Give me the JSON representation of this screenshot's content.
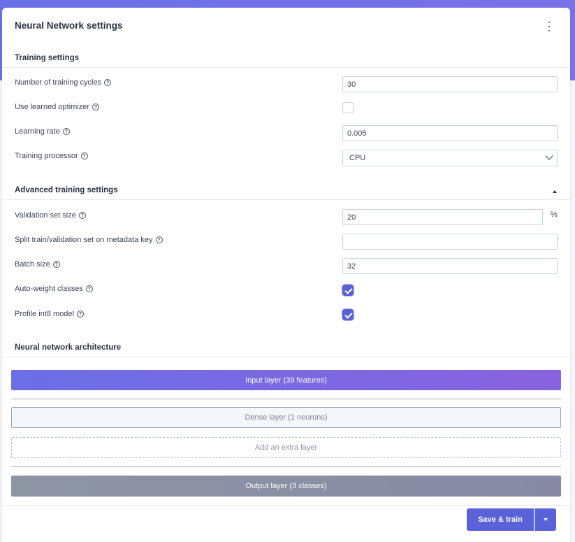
{
  "card": {
    "title": "Neural Network settings"
  },
  "training": {
    "heading": "Training settings",
    "cycles_label": "Number of training cycles",
    "cycles_value": "30",
    "optimizer_label": "Use learned optimizer",
    "optimizer_checked": false,
    "lr_label": "Learning rate",
    "lr_value": "0.005",
    "processor_label": "Training processor",
    "processor_value": "CPU"
  },
  "advanced": {
    "heading": "Advanced training settings",
    "validation_label": "Validation set size",
    "validation_value": "20",
    "validation_unit": "%",
    "split_label": "Split train/validation set on metadata key",
    "split_value": "",
    "batch_label": "Batch size",
    "batch_value": "32",
    "autoweight_label": "Auto-weight classes",
    "autoweight_checked": true,
    "profile_label": "Profile int8 model",
    "profile_checked": true
  },
  "architecture": {
    "heading": "Neural network architecture",
    "input_layer": "Input layer (39 features)",
    "dense_layer": "Dense layer (1 neurons)",
    "add_layer": "Add an extra layer",
    "output_layer": "Output layer (3 classes)"
  },
  "footer": {
    "save_label": "Save & train"
  },
  "help_glyph": "?",
  "colors": {
    "accent": "#5a62d9",
    "header_band": "#6a6fe6"
  }
}
